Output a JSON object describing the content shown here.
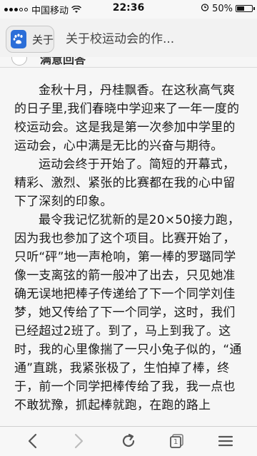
{
  "status_bar": {
    "carrier": "中国移动",
    "time": "22:36",
    "battery": "50%",
    "battery_level": 0.5
  },
  "browser": {
    "tab_label": "关于",
    "tab_icon": "baidu-paw-icon",
    "page_title": "关于校运动会的作..."
  },
  "article": {
    "subheader": "满意回答",
    "paragraphs": [
      "金秋十月，丹桂飘香。在这秋高气爽的日子里,我们春晓中学迎来了一年一度的校运动会。这是我是第一次参加中学里的运动会，心中满是无比的兴奋与期待。",
      "运动会终于开始了。简短的开幕式，精彩、激烈、紧张的比赛都在我的心中留下了深刻的印象。",
      "最令我记忆犹新的是20×50接力跑，因为我也参加了这个项目。比赛开始了，只听“砰”地一声枪响，第一棒的罗璐同学像一支离弦的箭一般冲了出去，只见她准确无误地把棒子传递给了下一个同学刘佳梦，她又传给了下一个同学，这时，我们已经超过2班了。到了，马上到我了。这时，我的心里像揣了一只小兔子似的，“通通”直跳，我紧张极了，生怕掉了棒，终于，前一个同学把棒传给了我，我一点也不敢犹豫，抓起棒就跑，在跑的路上"
    ]
  },
  "toolbar": {
    "back_icon": "back-arrow-icon",
    "forward_icon": "forward-arrow-icon",
    "refresh_icon": "refresh-icon",
    "tabs_count": "1",
    "menu_icon": "menu-icon"
  }
}
